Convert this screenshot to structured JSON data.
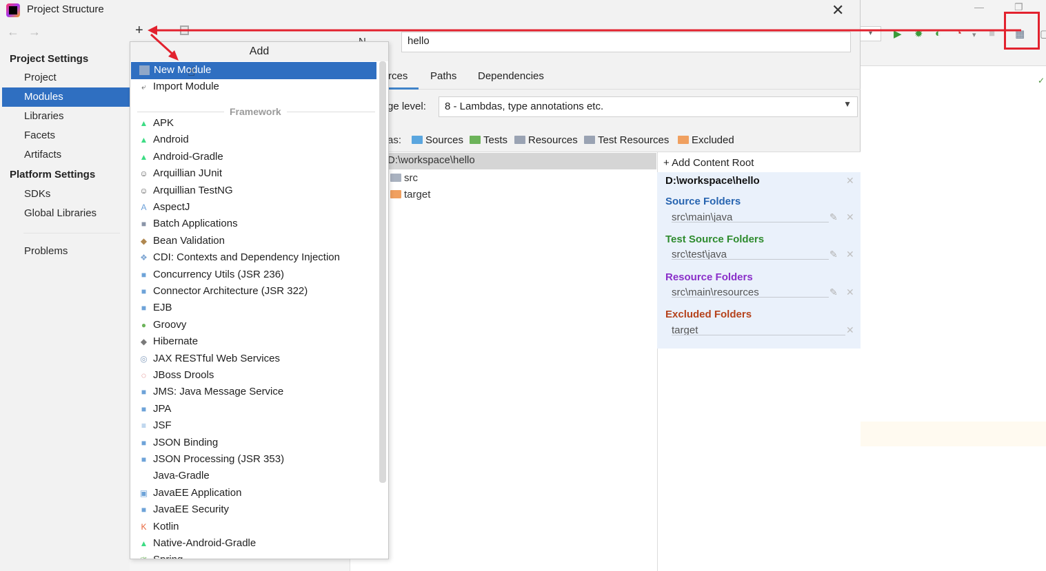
{
  "dialog": {
    "title": "Project Structure",
    "close_symbol": "✕",
    "nav_back": "←",
    "nav_forward": "→"
  },
  "sidebar": {
    "project_settings_header": "Project Settings",
    "project_settings_items": [
      "Project",
      "Modules",
      "Libraries",
      "Facets",
      "Artifacts"
    ],
    "platform_settings_header": "Platform Settings",
    "platform_settings_items": [
      "SDKs",
      "Global Libraries"
    ],
    "other_items": [
      "Problems"
    ],
    "selected": "Modules"
  },
  "toolbar": {
    "add_symbol": "+",
    "remove_symbol": "−"
  },
  "add_popup": {
    "title": "Add",
    "top_items": [
      {
        "label": "New Module",
        "icon": "module-icon",
        "selected": true
      },
      {
        "label": "Import Module",
        "icon": "import-icon"
      }
    ],
    "framework_header": "Framework",
    "frameworks": [
      {
        "label": "APK",
        "icon": "android-icon",
        "color": "#3ddc84",
        "glyph": "▲"
      },
      {
        "label": "Android",
        "icon": "android-icon",
        "color": "#3ddc84",
        "glyph": "▲"
      },
      {
        "label": "Android-Gradle",
        "icon": "android-icon",
        "color": "#3ddc84",
        "glyph": "▲"
      },
      {
        "label": "Arquillian JUnit",
        "icon": "arquillian-icon",
        "color": "#555555",
        "glyph": "☺"
      },
      {
        "label": "Arquillian TestNG",
        "icon": "arquillian-icon",
        "color": "#555555",
        "glyph": "☺"
      },
      {
        "label": "AspectJ",
        "icon": "aspectj-icon",
        "color": "#6a9fd8",
        "glyph": "A"
      },
      {
        "label": "Batch Applications",
        "icon": "batch-icon",
        "color": "#8a95a8",
        "glyph": "■"
      },
      {
        "label": "Bean Validation",
        "icon": "bean-validation-icon",
        "color": "#b08850",
        "glyph": "◆"
      },
      {
        "label": "CDI: Contexts and Dependency Injection",
        "icon": "cdi-icon",
        "color": "#7ca4d2",
        "glyph": "❖"
      },
      {
        "label": "Concurrency Utils (JSR 236)",
        "icon": "javaee-icon",
        "color": "#6ea3d8",
        "glyph": "■"
      },
      {
        "label": "Connector Architecture (JSR 322)",
        "icon": "javaee-icon",
        "color": "#6ea3d8",
        "glyph": "■"
      },
      {
        "label": "EJB",
        "icon": "ejb-icon",
        "color": "#6ea3d8",
        "glyph": "■"
      },
      {
        "label": "Groovy",
        "icon": "groovy-icon",
        "color": "#6cb35a",
        "glyph": "●"
      },
      {
        "label": "Hibernate",
        "icon": "hibernate-icon",
        "color": "#7a7a7a",
        "glyph": "◆"
      },
      {
        "label": "JAX RESTful Web Services",
        "icon": "globe-icon",
        "color": "#8aa2c0",
        "glyph": "◎"
      },
      {
        "label": "JBoss Drools",
        "icon": "drools-icon",
        "color": "#d04a4a",
        "glyph": "◌"
      },
      {
        "label": "JMS: Java Message Service",
        "icon": "javaee-icon",
        "color": "#6ea3d8",
        "glyph": "■"
      },
      {
        "label": "JPA",
        "icon": "jpa-icon",
        "color": "#6ea3d8",
        "glyph": "■"
      },
      {
        "label": "JSF",
        "icon": "jsf-icon",
        "color": "#6ea3d8",
        "glyph": "≡"
      },
      {
        "label": "JSON Binding",
        "icon": "javaee-icon",
        "color": "#6ea3d8",
        "glyph": "■"
      },
      {
        "label": "JSON Processing (JSR 353)",
        "icon": "javaee-icon",
        "color": "#6ea3d8",
        "glyph": "■"
      },
      {
        "label": "Java-Gradle",
        "icon": "",
        "color": "#ffffff",
        "glyph": ""
      },
      {
        "label": "JavaEE Application",
        "icon": "javaee-app-icon",
        "color": "#6ea3d8",
        "glyph": "▣"
      },
      {
        "label": "JavaEE Security",
        "icon": "javaee-icon",
        "color": "#6ea3d8",
        "glyph": "■"
      },
      {
        "label": "Kotlin",
        "icon": "kotlin-icon",
        "color": "#e8643a",
        "glyph": "K"
      },
      {
        "label": "Native-Android-Gradle",
        "icon": "android-icon",
        "color": "#3ddc84",
        "glyph": "▲"
      },
      {
        "label": "Spring",
        "icon": "spring-icon",
        "color": "#6cb35a",
        "glyph": "❦"
      }
    ]
  },
  "module": {
    "name_label": "N",
    "name_value": "hello",
    "tabs": [
      "rces",
      "Paths",
      "Dependencies"
    ],
    "language_level_label": "ge level:",
    "language_level_value": "8 - Lambdas, type annotations etc.",
    "mark_as_label": "as:",
    "mark_as": [
      {
        "label": "Sources",
        "color": "#5aa6df"
      },
      {
        "label": "Tests",
        "color": "#6cb35a"
      },
      {
        "label": "Resources",
        "color": "#9aa3b3"
      },
      {
        "label": "Test Resources",
        "color": "#9aa3b3"
      },
      {
        "label": "Excluded",
        "color": "#f0a060"
      }
    ],
    "tree": {
      "root": "D:\\workspace\\hello",
      "children": [
        {
          "label": "src",
          "color": "#a9b2c0"
        },
        {
          "label": "target",
          "color": "#f0a060"
        }
      ]
    }
  },
  "content_roots": {
    "add_label": "Add Content Root",
    "root_path": "D:\\workspace\\hello",
    "groups": [
      {
        "heading": "Source Folders",
        "value": "src\\main\\java",
        "color": "#2764b0",
        "editable": true
      },
      {
        "heading": "Test Source Folders",
        "value": "src\\test\\java",
        "color": "#2e8b2e",
        "editable": true
      },
      {
        "heading": "Resource Folders",
        "value": "src\\main\\resources",
        "color": "#8a2fc9",
        "editable": true
      },
      {
        "heading": "Excluded Folders",
        "value": "target",
        "color": "#b5421b",
        "editable": false
      }
    ]
  },
  "annotation": {
    "color": "#e2222e"
  }
}
